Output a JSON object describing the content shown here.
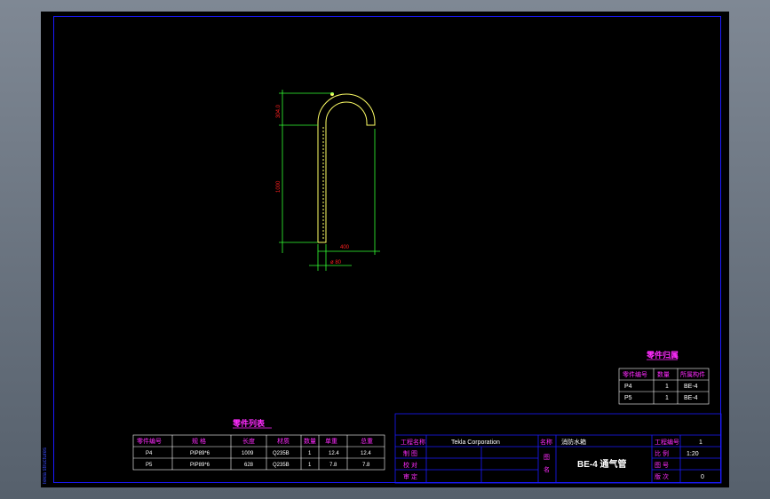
{
  "drawing": {
    "dims": {
      "arc_height": "304.0",
      "straight_height": "1000",
      "width": "400",
      "diameter": "ø 80"
    }
  },
  "parts_table": {
    "title": "零件列表",
    "headers": [
      "零件编号",
      "规 格",
      "长度",
      "材质",
      "数量",
      "单重",
      "总重"
    ],
    "rows": [
      [
        "P4",
        "PIP89*6",
        "1009",
        "Q235B",
        "1",
        "12.4",
        "12.4"
      ],
      [
        "P5",
        "PIP89*6",
        "628",
        "Q235B",
        "1",
        "7.8",
        "7.8"
      ]
    ]
  },
  "parts_return": {
    "title": "零件归属",
    "headers": [
      "零件编号",
      "数量",
      "所属构件"
    ],
    "rows": [
      [
        "P4",
        "1",
        "BE-4"
      ],
      [
        "P5",
        "1",
        "BE-4"
      ]
    ]
  },
  "title_block": {
    "project_label": "工程名称",
    "company": "Tekla Corporation",
    "name_label": "名称",
    "name_value": "消防水箱",
    "number_label": "工程编号",
    "number_value": "1",
    "draw_label": "制 图",
    "check_label": "校 对",
    "review_label": "审 定",
    "figure_label_1": "图",
    "figure_label_2": "名",
    "figure_name": "BE-4 通气管",
    "scale_label": "比 例",
    "scale_value": "1:20",
    "drawing_no_label": "图 号",
    "version_label": "版 次",
    "version_value": "0"
  },
  "side_label": "Tekla structures",
  "colors": {
    "frame": "#1a1aff",
    "pipe": "#ffff66",
    "dimension": "#33ff33",
    "dim_text": "#ff2020",
    "table_title": "#ff2bff"
  }
}
